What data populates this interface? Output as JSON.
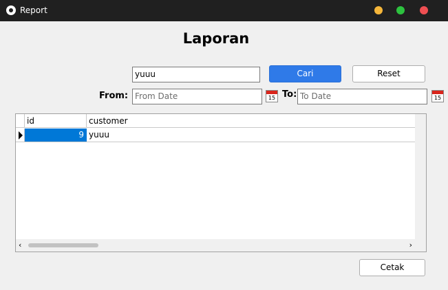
{
  "window": {
    "title": "Report",
    "icon": "paw-icon",
    "controls": {
      "minimize_color": "#f5b63a",
      "maximize_color": "#2dc23f",
      "close_color": "#ef4f52"
    }
  },
  "page": {
    "title": "Laporan"
  },
  "search": {
    "value": "yuuu",
    "button_label": "Cari",
    "button_color": "#2f7ae8"
  },
  "reset": {
    "label": "Reset"
  },
  "filters": {
    "from_label": "From:",
    "from_placeholder": "From Date",
    "to_label": "To:",
    "to_placeholder": "To Date",
    "calendar_day": "15"
  },
  "table": {
    "columns": [
      "id",
      "customer"
    ],
    "rows": [
      {
        "id": "9",
        "customer": "yuuu"
      }
    ],
    "selection_color": "#0078d7"
  },
  "footer": {
    "print_label": "Cetak"
  }
}
